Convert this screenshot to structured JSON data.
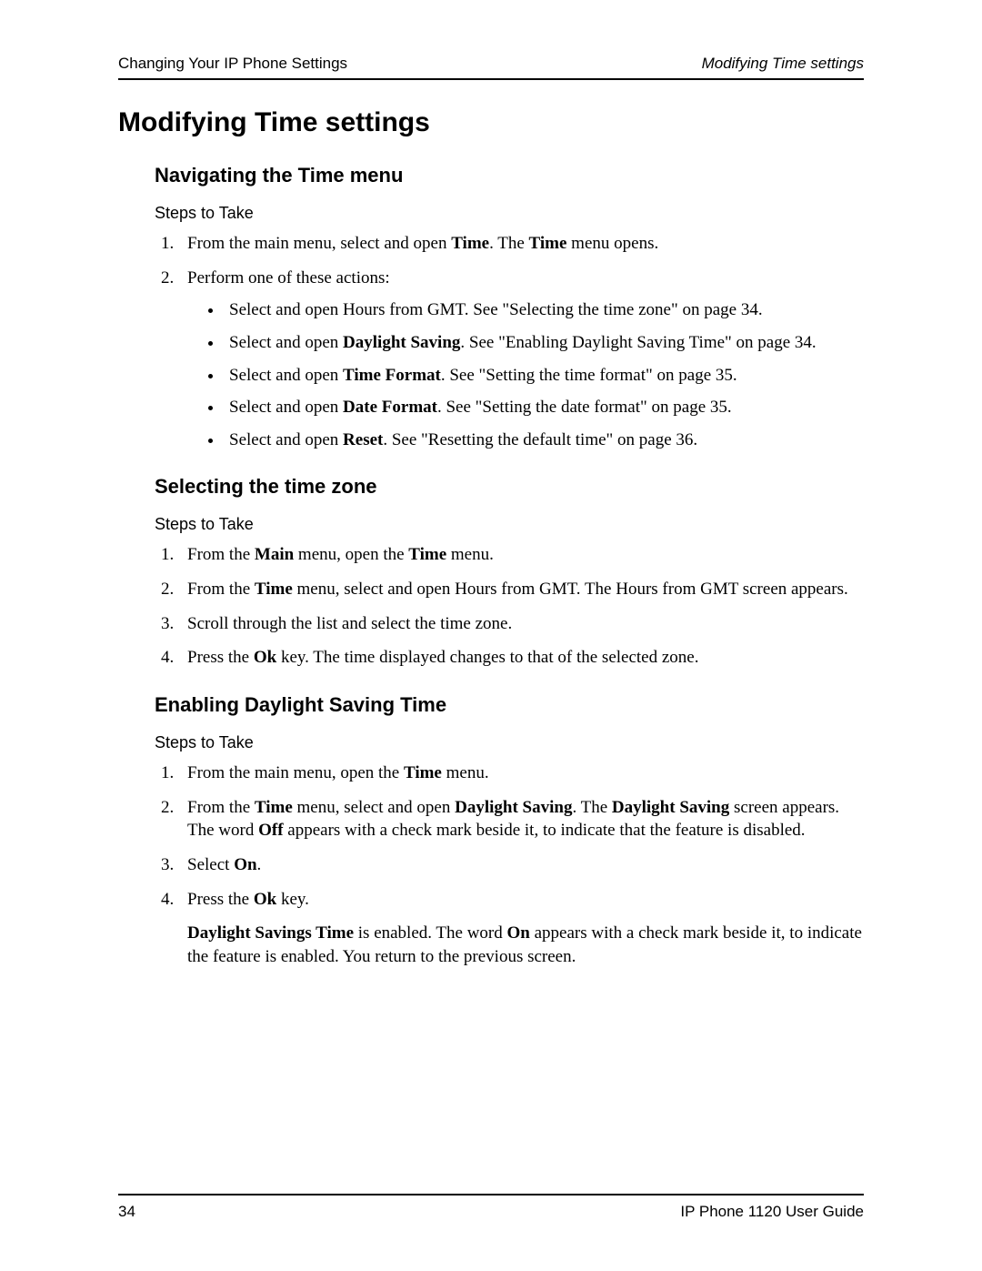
{
  "header": {
    "left": "Changing Your IP Phone Settings",
    "right": "Modifying Time settings"
  },
  "title": "Modifying Time settings",
  "sections": [
    {
      "heading": "Navigating the Time menu",
      "steps_label": "Steps to Take",
      "steps": [
        {
          "prefix": "From the main menu, select and open ",
          "b1": "Time",
          "mid": ". The ",
          "b2": "Time",
          "suffix": " menu opens."
        },
        {
          "prefix": "Perform one of these actions:",
          "bullets": [
            {
              "prefix": "Select and open Hours from GMT. See \"Selecting the time zone\" on page 34."
            },
            {
              "prefix": "Select and open ",
              "b1": "Daylight Saving",
              "suffix": ". See \"Enabling Daylight Saving Time\" on page 34."
            },
            {
              "prefix": "Select and open ",
              "b1": "Time Format",
              "suffix": ". See \"Setting the time format\" on page 35."
            },
            {
              "prefix": "Select and open ",
              "b1": "Date Format",
              "suffix": ". See \"Setting the date format\" on page 35."
            },
            {
              "prefix": "Select and open ",
              "b1": "Reset",
              "suffix": ". See \"Resetting the default time\" on page 36."
            }
          ]
        }
      ]
    },
    {
      "heading": "Selecting the time zone",
      "steps_label": "Steps to Take",
      "steps": [
        {
          "prefix": "From the ",
          "b1": "Main",
          "mid": " menu, open the ",
          "b2": "Time",
          "suffix": " menu."
        },
        {
          "prefix": "From the ",
          "b1": "Time",
          "suffix": " menu, select and open Hours from GMT. The Hours from GMT screen appears."
        },
        {
          "prefix": "Scroll through the list and select the time zone."
        },
        {
          "prefix": "Press the ",
          "b1": "Ok",
          "suffix": " key. The time displayed changes to that of the selected zone."
        }
      ]
    },
    {
      "heading": "Enabling Daylight Saving Time",
      "steps_label": "Steps to Take",
      "steps": [
        {
          "prefix": "From the main menu, open the ",
          "b1": "Time",
          "suffix": " menu."
        },
        {
          "prefix": "From the ",
          "b1": "Time",
          "mid": " menu, select and open ",
          "b2": "Daylight Saving",
          "mid2": ". The ",
          "b3": "Daylight Saving",
          "mid3": " screen appears. The word ",
          "b4": "Off",
          "suffix": " appears with a check mark beside it, to indicate that the feature is disabled."
        },
        {
          "prefix": "Select ",
          "b1": "On",
          "suffix": "."
        },
        {
          "prefix": "Press the ",
          "b1": "Ok",
          "suffix": " key.",
          "followup": {
            "b1": "Daylight Savings Time",
            "mid": " is enabled. The word ",
            "b2": "On",
            "suffix": " appears with a check mark beside it, to indicate the feature is enabled. You return to the previous screen."
          }
        }
      ]
    }
  ],
  "footer": {
    "page_number": "34",
    "doc_title": "IP Phone 1120 User Guide"
  }
}
